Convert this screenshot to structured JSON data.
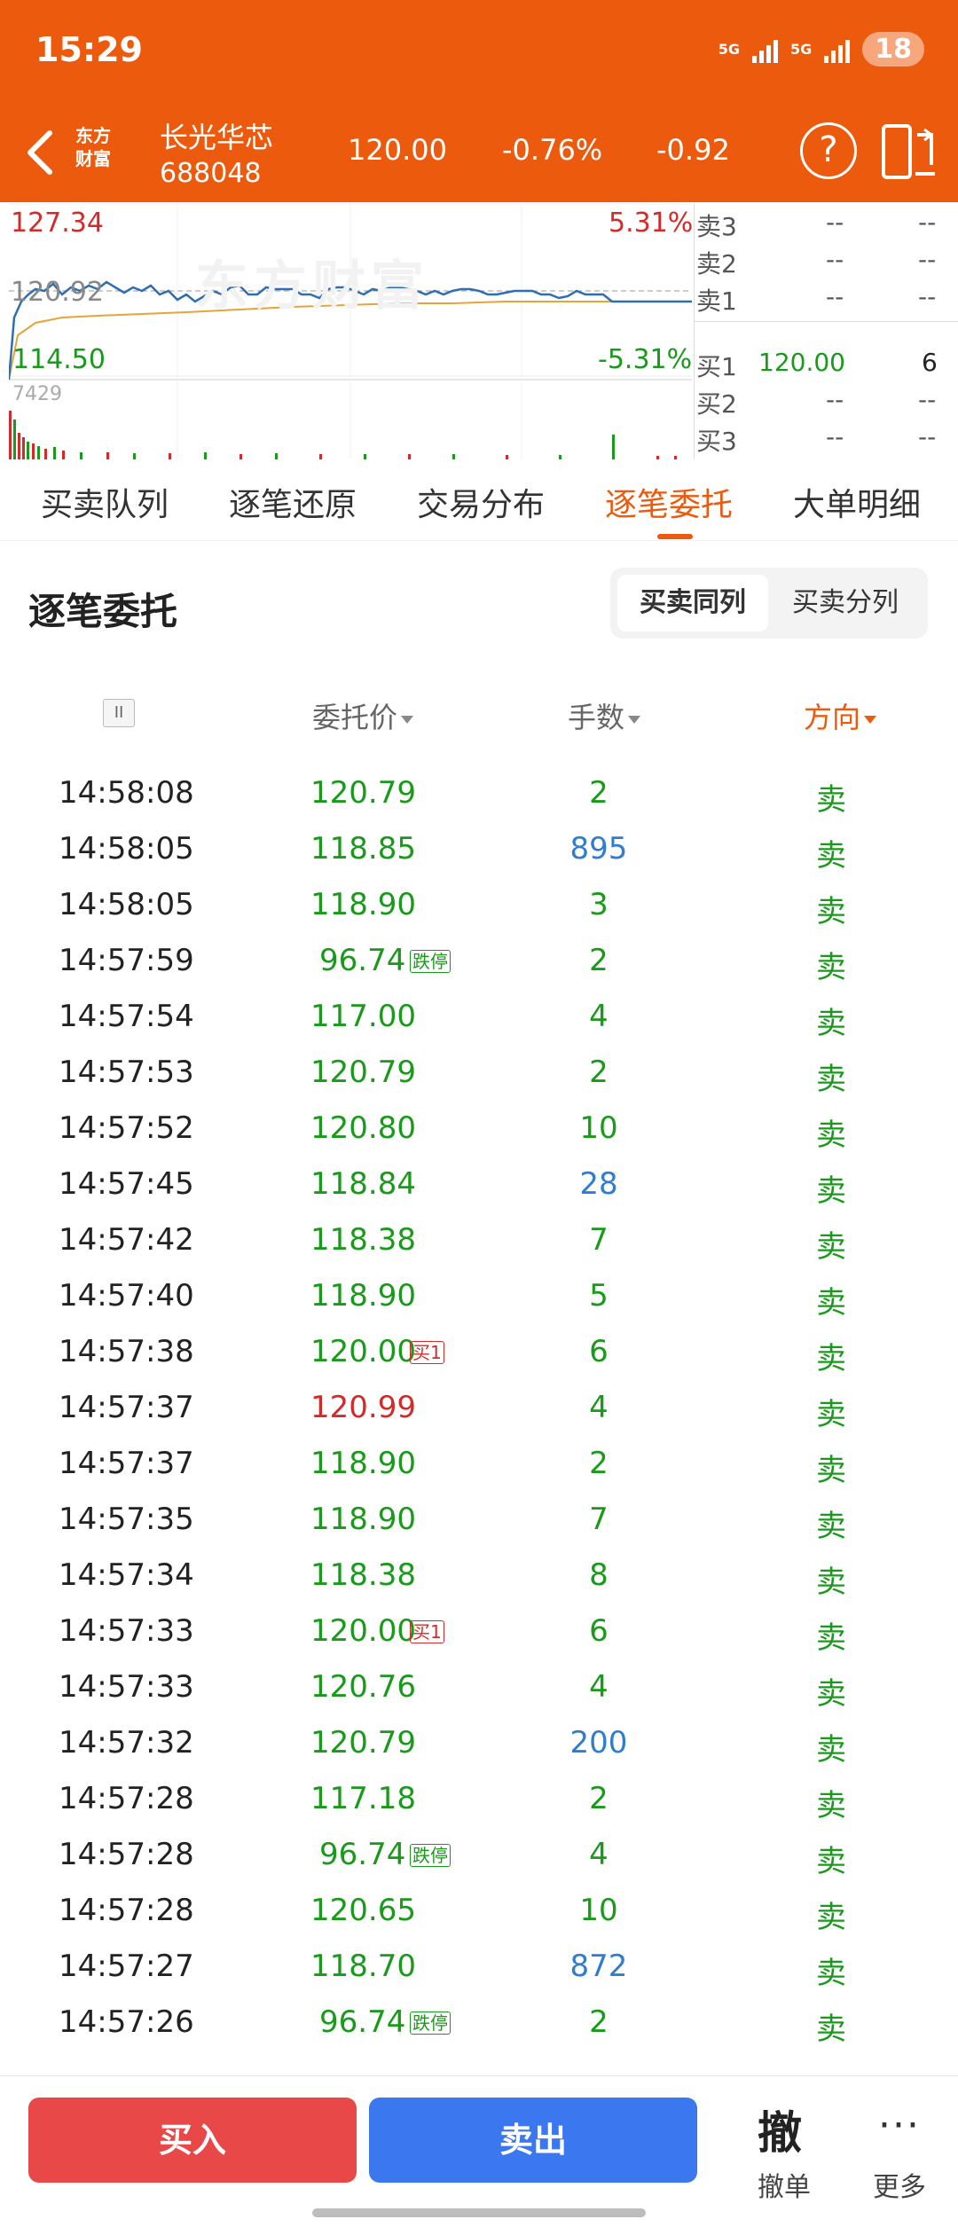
{
  "status_bar": {
    "time": "15:29",
    "signal1": "5G",
    "signal2": "5G",
    "battery": "18"
  },
  "header": {
    "logo_line1": "东方",
    "logo_line2": "财富",
    "stock_name": "长光华芯",
    "stock_code": "688048",
    "price": "120.00",
    "change_pct": "-0.76%",
    "change": "-0.92",
    "help_label": "?"
  },
  "chart": {
    "high": "127.34",
    "high_pct": "5.31%",
    "prev_close": "120.92",
    "low": "114.50",
    "low_pct": "-5.31%",
    "volume_max": "7429",
    "watermark": "东方财富"
  },
  "depth": [
    {
      "label": "卖3",
      "price": "--",
      "vol": "--"
    },
    {
      "label": "卖2",
      "price": "--",
      "vol": "--"
    },
    {
      "label": "卖1",
      "price": "--",
      "vol": "--"
    },
    {
      "label": "买1",
      "price": "120.00",
      "vol": "6"
    },
    {
      "label": "买2",
      "price": "--",
      "vol": "--"
    },
    {
      "label": "买3",
      "price": "--",
      "vol": "--"
    }
  ],
  "tabs": [
    "买卖队列",
    "逐笔还原",
    "交易分布",
    "逐笔委托",
    "大单明细"
  ],
  "active_tab": "逐笔委托",
  "section": {
    "title": "逐笔委托",
    "toggle": [
      "买卖同列",
      "买卖分列"
    ],
    "active_toggle": "买卖同列"
  },
  "columns": {
    "pause": "II",
    "price": "委托价",
    "qty": "手数",
    "direction": "方向"
  },
  "rows": [
    {
      "time": "14:58:08",
      "price": "120.79",
      "qty": "2",
      "dir": "卖"
    },
    {
      "time": "14:58:05",
      "price": "118.85",
      "qty": "895",
      "dir": "卖",
      "qty_color": "blue"
    },
    {
      "time": "14:58:05",
      "price": "118.90",
      "qty": "3",
      "dir": "卖"
    },
    {
      "time": "14:57:59",
      "price": "96.74",
      "tag": "跌停",
      "qty": "2",
      "dir": "卖"
    },
    {
      "time": "14:57:54",
      "price": "117.00",
      "qty": "4",
      "dir": "卖"
    },
    {
      "time": "14:57:53",
      "price": "120.79",
      "qty": "2",
      "dir": "卖"
    },
    {
      "time": "14:57:52",
      "price": "120.80",
      "qty": "10",
      "dir": "卖"
    },
    {
      "time": "14:57:45",
      "price": "118.84",
      "qty": "28",
      "dir": "卖",
      "qty_color": "blue"
    },
    {
      "time": "14:57:42",
      "price": "118.38",
      "qty": "7",
      "dir": "卖"
    },
    {
      "time": "14:57:40",
      "price": "118.90",
      "qty": "5",
      "dir": "卖"
    },
    {
      "time": "14:57:38",
      "price": "120.00",
      "tag": "买1",
      "qty": "6",
      "dir": "卖"
    },
    {
      "time": "14:57:37",
      "price": "120.99",
      "qty": "4",
      "dir": "卖",
      "price_color": "red"
    },
    {
      "time": "14:57:37",
      "price": "118.90",
      "qty": "2",
      "dir": "卖"
    },
    {
      "time": "14:57:35",
      "price": "118.90",
      "qty": "7",
      "dir": "卖"
    },
    {
      "time": "14:57:34",
      "price": "118.38",
      "qty": "8",
      "dir": "卖"
    },
    {
      "time": "14:57:33",
      "price": "120.00",
      "tag": "买1",
      "qty": "6",
      "dir": "卖"
    },
    {
      "time": "14:57:33",
      "price": "120.76",
      "qty": "4",
      "dir": "卖"
    },
    {
      "time": "14:57:32",
      "price": "120.79",
      "qty": "200",
      "dir": "卖",
      "qty_color": "blue"
    },
    {
      "time": "14:57:28",
      "price": "117.18",
      "qty": "2",
      "dir": "卖"
    },
    {
      "time": "14:57:28",
      "price": "96.74",
      "tag": "跌停",
      "qty": "4",
      "dir": "卖"
    },
    {
      "time": "14:57:28",
      "price": "120.65",
      "qty": "10",
      "dir": "卖"
    },
    {
      "time": "14:57:27",
      "price": "118.70",
      "qty": "872",
      "dir": "卖",
      "qty_color": "blue"
    },
    {
      "time": "14:57:26",
      "price": "96.74",
      "tag": "跌停",
      "qty": "2",
      "dir": "卖"
    }
  ],
  "bottom": {
    "buy": "买入",
    "sell": "卖出",
    "cancel_big": "撤",
    "cancel_label": "撤单",
    "more_icon": "···",
    "more_label": "更多"
  },
  "colors": {
    "accent": "#ec5a0d",
    "green": "#1a9a1a",
    "red": "#d42a2a",
    "blue": "#2f7dd1",
    "buy": "#e84848",
    "sell": "#3b78f0"
  }
}
